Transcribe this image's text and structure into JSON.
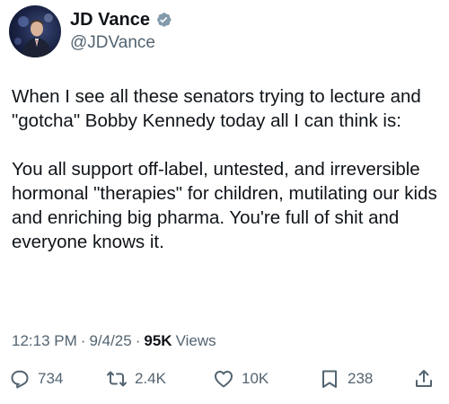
{
  "author": {
    "display_name": "JD Vance",
    "handle": "@JDVance",
    "verified": true,
    "verified_color": "#829aab"
  },
  "tweet": {
    "paragraphs": [
      "When I see all these senators trying to lecture and \"gotcha\" Bobby Kennedy today all I can think is:",
      "You all support off-label, untested, and irreversible hormonal \"therapies\" for children, mutilating our kids and enriching big pharma. You're full of shit and everyone knows it."
    ]
  },
  "meta": {
    "time": "12:13 PM",
    "separator": "·",
    "date": "9/4/25",
    "views_count": "95K",
    "views_label": "Views"
  },
  "actions": {
    "reply_count": "734",
    "repost_count": "2.4K",
    "like_count": "10K",
    "bookmark_count": "238",
    "icon_color": "#536471"
  }
}
